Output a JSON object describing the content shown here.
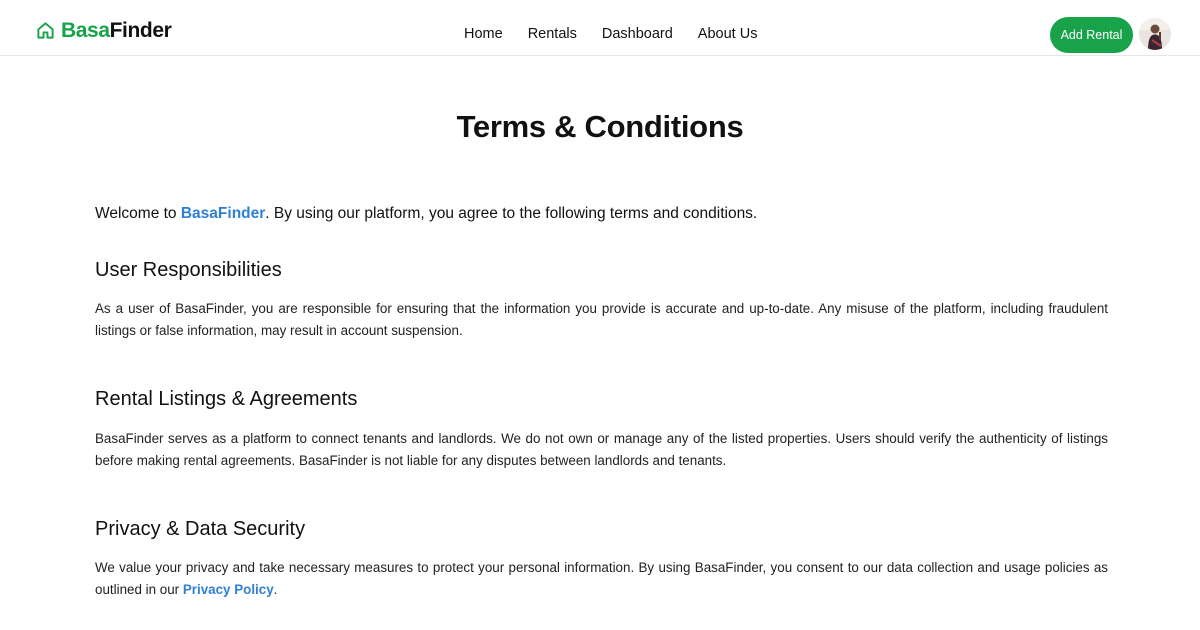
{
  "brand": {
    "name_part1": "Basa",
    "name_part2": "Finder",
    "accent_color": "#18a34a",
    "logo_icon": "home-icon"
  },
  "nav": {
    "items": [
      {
        "label": "Home"
      },
      {
        "label": "Rentals"
      },
      {
        "label": "Dashboard"
      },
      {
        "label": "About Us"
      }
    ],
    "add_rental_label": "Add Rental"
  },
  "page": {
    "title": "Terms & Conditions",
    "intro": {
      "before": "Welcome to ",
      "brand": "BasaFinder",
      "after": ". By using our platform, you agree to the following terms and conditions."
    },
    "sections": [
      {
        "heading": "User Responsibilities",
        "body": "As a user of BasaFinder, you are responsible for ensuring that the information you provide is accurate and up-to-date. Any misuse of the platform, including fraudulent listings or false information, may result in account suspension."
      },
      {
        "heading": "Rental Listings & Agreements",
        "body": "BasaFinder serves as a platform to connect tenants and landlords. We do not own or manage any of the listed properties. Users should verify the authenticity of listings before making rental agreements. BasaFinder is not liable for any disputes between landlords and tenants."
      },
      {
        "heading": "Privacy & Data Security",
        "body_before": "We value your privacy and take necessary measures to protect your personal information. By using BasaFinder, you consent to our data collection and usage policies as outlined in our ",
        "link": "Privacy Policy",
        "body_after": "."
      }
    ],
    "link_color": "#2f7fd6"
  }
}
